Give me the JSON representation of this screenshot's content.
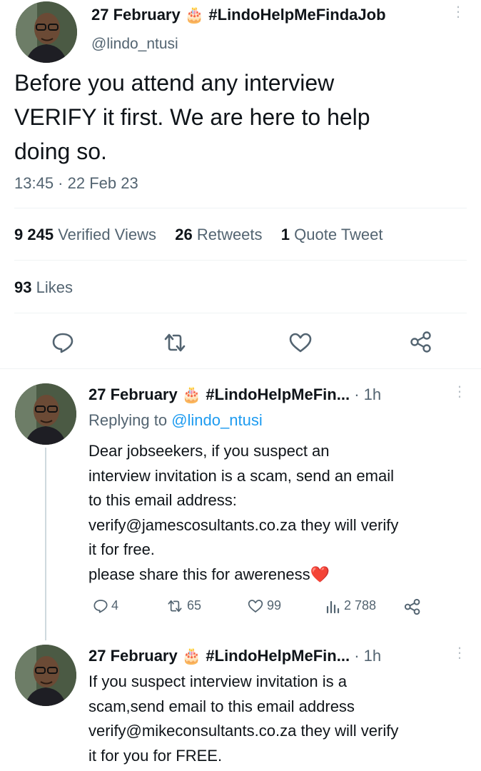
{
  "main_tweet": {
    "display_name": "27 February",
    "cake_emoji": "🎂",
    "hashtag": "#LindoHelpMeFindaJob",
    "handle": "@lindo_ntusi",
    "text_line1": "Before you attend any interview",
    "text_line2": "VERIFY it first. We are here to help",
    "text_line3": "doing so.",
    "timestamp": "13:45 · 22 Feb 23",
    "stats": {
      "views_count": "9 245",
      "views_label": "Verified Views",
      "retweets_count": "26",
      "retweets_label": "Retweets",
      "quotes_count": "1",
      "quotes_label": "Quote Tweet",
      "likes_count": "93",
      "likes_label": "Likes"
    }
  },
  "reply1": {
    "display_name": "27 February",
    "cake_emoji": "🎂",
    "hashtag": "#LindoHelpMeFin...",
    "time": "· 1h",
    "replying_prefix": "Replying to",
    "replying_handle": "@lindo_ntusi",
    "line1": "Dear jobseekers,  if  you suspect an",
    "line2": "interview invitation is a scam,  send an email",
    "line3": "to this email address:",
    "line4": "verify@jamescosultants.co.za they will verify",
    "line5": "it for free.",
    "line6": "please share this for awereness",
    "heart_emoji": "❤️",
    "actions": {
      "replies": "4",
      "retweets": "65",
      "likes": "99",
      "views": "2 788"
    }
  },
  "reply2": {
    "display_name": "27 February",
    "cake_emoji": "🎂",
    "hashtag": "#LindoHelpMeFin...",
    "time": "· 1h",
    "line1": "If you suspect interview invitation is a",
    "line2": "scam,send email to this email address",
    "line3": "verify@mikeconsultants.co.za they will verify",
    "line4": "it for you for FREE."
  },
  "colors": {
    "text": "#0f1419",
    "secondary": "#536471",
    "link": "#1d9bf0",
    "heart": "#e0245e"
  },
  "icons": [
    "reply-icon",
    "retweet-icon",
    "like-icon",
    "share-icon",
    "views-icon",
    "more-icon"
  ]
}
